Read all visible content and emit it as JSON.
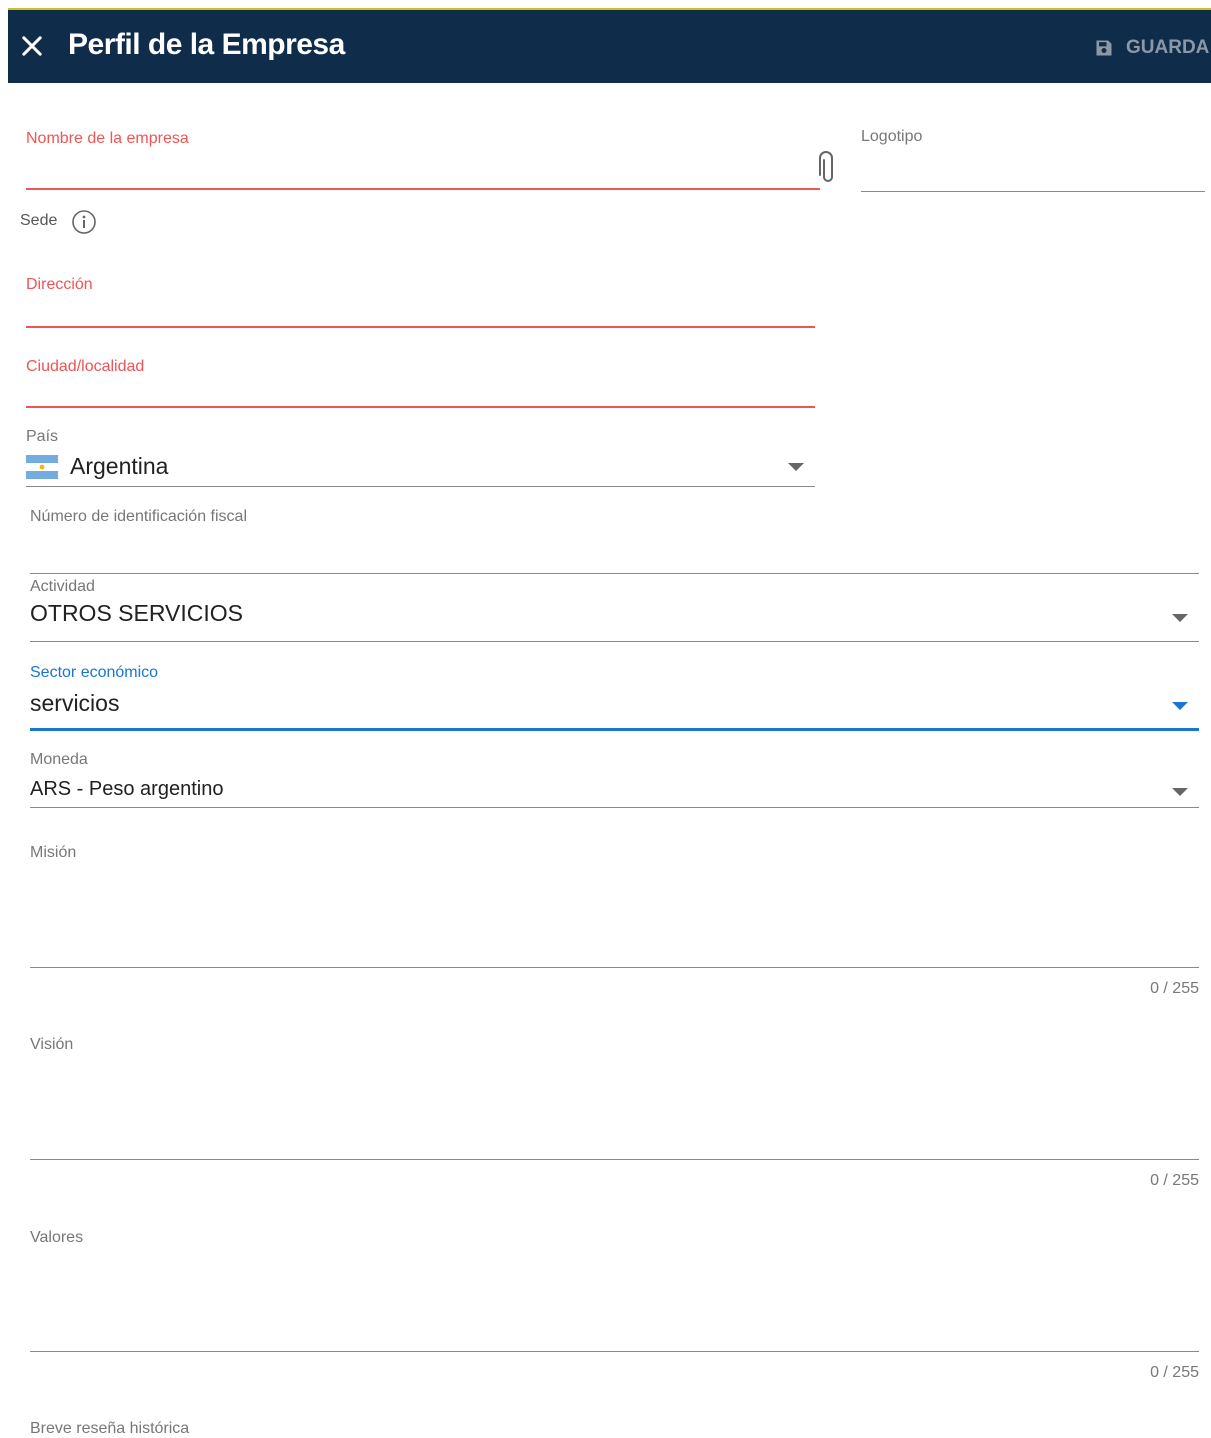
{
  "header": {
    "title": "Perfil de la Empresa",
    "save_label": "GUARDA"
  },
  "form": {
    "company_name": {
      "label": "Nombre de la empresa",
      "value": ""
    },
    "logo": {
      "label": "Logotipo"
    },
    "sede": {
      "label": "Sede"
    },
    "address": {
      "label": "Dirección",
      "value": ""
    },
    "city": {
      "label": "Ciudad/localidad",
      "value": ""
    },
    "country": {
      "label": "País",
      "value": "Argentina",
      "flag": "argentina-flag-icon"
    },
    "tax_id": {
      "label": "Número de identificación fiscal",
      "value": ""
    },
    "activity": {
      "label": "Actividad",
      "value": "OTROS SERVICIOS"
    },
    "economic_sector": {
      "label": "Sector económico",
      "value": "servicios"
    },
    "currency": {
      "label": "Moneda",
      "value": "ARS - Peso argentino"
    },
    "mission": {
      "label": "Misión",
      "counter": "0 / 255"
    },
    "vision": {
      "label": "Visión",
      "counter": "0 / 255"
    },
    "values": {
      "label": "Valores",
      "counter": "0 / 255"
    },
    "history": {
      "label": "Breve reseña histórica"
    }
  },
  "colors": {
    "header_bg": "#0f2d4b",
    "error": "#f05454",
    "focus": "#1976d2"
  }
}
